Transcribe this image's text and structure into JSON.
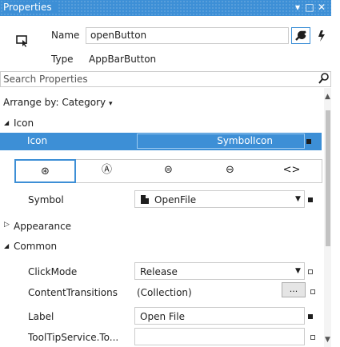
{
  "window": {
    "title": "Properties",
    "pin_glyph": "▾",
    "maximize_glyph": "□",
    "close_glyph": "✕"
  },
  "header": {
    "name_label": "Name",
    "name_value": "openButton",
    "type_label": "Type",
    "type_value": "AppBarButton",
    "properties_icon": "wrench-icon",
    "events_icon": "lightning-icon"
  },
  "search": {
    "placeholder": "Search Properties"
  },
  "arrange": {
    "label": "Arrange by: Category",
    "arrow": "▾"
  },
  "categories": {
    "icon": "Icon",
    "appearance": "Appearance",
    "common": "Common",
    "expanded_glyph": "◢",
    "collapsed_glyph": "▷"
  },
  "icon_row": {
    "label": "Icon",
    "value": "SymbolIcon"
  },
  "icon_tabs": [
    {
      "name": "symbol-icon-tab",
      "glyph": "⊛"
    },
    {
      "name": "font-icon-tab",
      "glyph": "Ⓐ"
    },
    {
      "name": "bitmap-icon-tab",
      "glyph": "⊜"
    },
    {
      "name": "path-icon-tab",
      "glyph": "⊖"
    },
    {
      "name": "code-icon-tab",
      "glyph": "<>"
    }
  ],
  "symbol": {
    "label": "Symbol",
    "value": "OpenFile"
  },
  "common_props": [
    {
      "label": "ClickMode",
      "value": "Release"
    },
    {
      "label": "ContentTransitions",
      "value": "(Collection)",
      "button": "..."
    },
    {
      "label": "Label",
      "value": "Open File"
    },
    {
      "label": "ToolTipService.To...",
      "value": ""
    }
  ]
}
